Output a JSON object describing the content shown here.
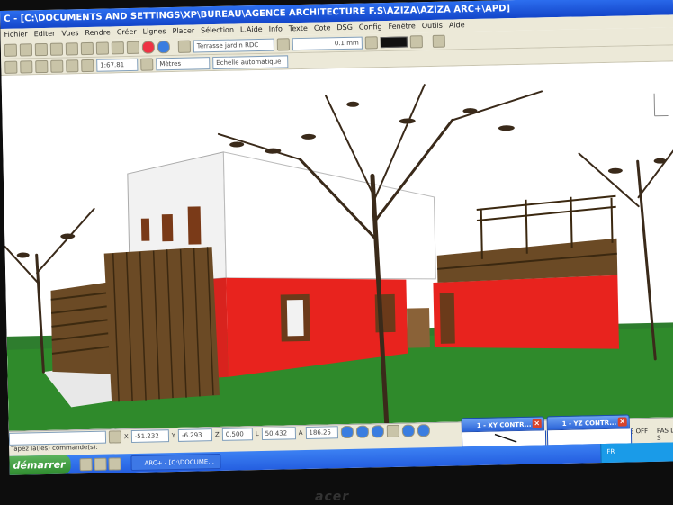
{
  "window": {
    "title": "C - [C:\\DOCUMENTS AND SETTINGS\\XP\\BUREAU\\AGENCE ARCHITECTURE F.S\\AZIZA\\AZIZA ARC+\\APD]"
  },
  "menu": [
    "Fichier",
    "Editer",
    "Vues",
    "Rendre",
    "Créer",
    "Lignes",
    "Placer",
    "Sélection",
    "L.Aide",
    "Info",
    "Texte",
    "Cote",
    "DSG",
    "Config",
    "Fenêtre",
    "Outils",
    "Aide"
  ],
  "toolbar1": {
    "layer": "Terrasse jardin RDC",
    "line_thickness": "0.1 mm"
  },
  "toolbar2": {
    "scale": "1:67.81",
    "units": "Mètres",
    "scale_mode": "Echelle automatique"
  },
  "coords": {
    "x_label": "X",
    "x": "-51.232",
    "y_label": "Y",
    "y": "-6.293",
    "z_label": "Z",
    "z": "0.500",
    "l_label": "L",
    "l": "50.432",
    "a_label": "A",
    "a": "186.25"
  },
  "status": {
    "command_prompt": "Tapez la(les) commande(s):",
    "snap": "PAS DE S",
    "off": "S OFF"
  },
  "control_windows": [
    {
      "label": "1 - XY CONTR..."
    },
    {
      "label": "1 - YZ CONTR..."
    }
  ],
  "taskbar": {
    "start_label": "démarrer",
    "task_label": "ARC+ - [C:\\DOCUME...",
    "language": "FR"
  },
  "monitor": {
    "brand": "acer"
  },
  "colors": {
    "titlebar": "#1345c9",
    "sky": "#ffffff",
    "grass": "#2f8a2b",
    "wall_red": "#e8231e",
    "wall_white": "#f4f4f4",
    "wood": "#5a3d1e"
  }
}
